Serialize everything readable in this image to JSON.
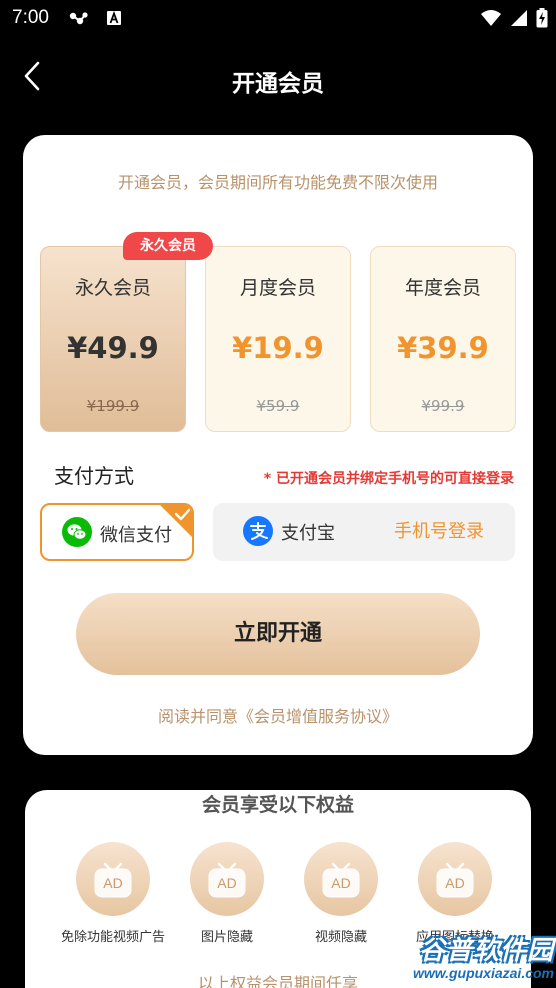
{
  "status_bar": {
    "time": "7:00",
    "icons": [
      "accessibility-icon",
      "a-box-icon",
      "wifi-icon",
      "signal-icon",
      "battery-charging-icon"
    ]
  },
  "header": {
    "back_icon": "chevron-left-icon",
    "title": "开通会员"
  },
  "membership": {
    "subtitle": "开通会员，会员期间所有功能免费不限次使用",
    "badge": "永久会员",
    "plans": [
      {
        "name": "永久会员",
        "price": "¥49.9",
        "original_price": "¥199.9",
        "selected": true
      },
      {
        "name": "月度会员",
        "price": "¥19.9",
        "original_price": "¥59.9",
        "selected": false
      },
      {
        "name": "年度会员",
        "price": "¥39.9",
        "original_price": "¥99.9",
        "selected": false
      }
    ]
  },
  "payment": {
    "title": "支付方式",
    "note": "* 已开通会员并绑定手机号的可直接登录",
    "methods": [
      {
        "label": "微信支付",
        "icon": "wechat-icon",
        "selected": true
      },
      {
        "label": "支付宝",
        "icon": "alipay-icon",
        "selected": false
      }
    ],
    "phone_login": "手机号登录"
  },
  "open_button": "立即开通",
  "agreement": "阅读并同意《会员增值服务协议》",
  "benefits": {
    "title": "会员享受以下权益",
    "icon_text": "AD",
    "items": [
      {
        "label": "免除功能视频广告",
        "icon": "ad-tv-icon"
      },
      {
        "label": "图片隐藏",
        "icon": "ad-tv-icon"
      },
      {
        "label": "视频隐藏",
        "icon": "ad-tv-icon"
      },
      {
        "label": "应用图标替换",
        "icon": "ad-tv-icon"
      }
    ],
    "footer": "以上权益会员期间任享"
  },
  "watermark": {
    "logo": "谷普软件园",
    "url": "www.gupuxiazai.com"
  },
  "colors": {
    "accent": "#f0942e",
    "gold_text": "#b8926a",
    "badge_red": "#f04849",
    "note_red": "#e53935",
    "wechat_green": "#09bb07",
    "alipay_blue": "#1677ff"
  }
}
